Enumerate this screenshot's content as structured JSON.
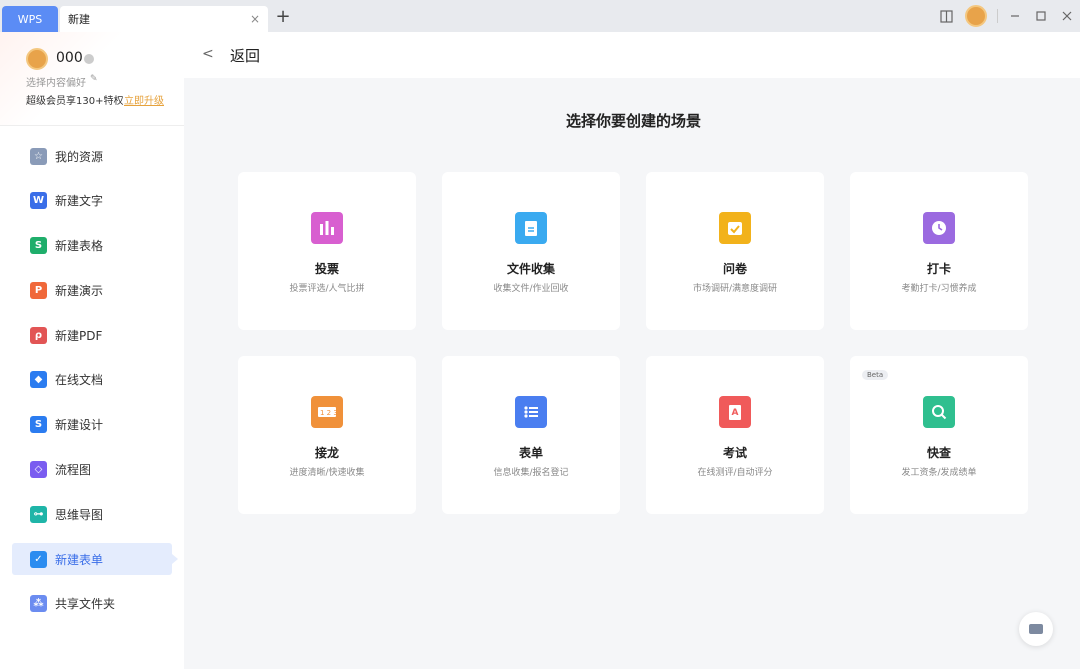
{
  "titlebar": {
    "tab_wps": "WPS",
    "tab_new": "新建",
    "tab_close": "×",
    "tab_add": "+"
  },
  "profile": {
    "name": "000",
    "pref": "选择内容偏好",
    "vip": "超级会员享130+特权",
    "upgrade": "立即升级"
  },
  "sidebar": {
    "items": [
      {
        "label": "我的资源",
        "icon": "star-icon",
        "color": "#8a9bb8",
        "glyph": "☆"
      },
      {
        "label": "新建文字",
        "icon": "word-icon",
        "color": "#3a6ee8",
        "glyph": "W"
      },
      {
        "label": "新建表格",
        "icon": "sheet-icon",
        "color": "#1fae6b",
        "glyph": "S"
      },
      {
        "label": "新建演示",
        "icon": "slides-icon",
        "color": "#f0683a",
        "glyph": "P"
      },
      {
        "label": "新建PDF",
        "icon": "pdf-icon",
        "color": "#e25555",
        "glyph": "ρ"
      },
      {
        "label": "在线文档",
        "icon": "online-doc-icon",
        "color": "#2b7cf0",
        "glyph": "◆"
      },
      {
        "label": "新建设计",
        "icon": "design-icon",
        "color": "#2b7cf0",
        "glyph": "S"
      },
      {
        "label": "流程图",
        "icon": "flowchart-icon",
        "color": "#7a5cf0",
        "glyph": "◇"
      },
      {
        "label": "思维导图",
        "icon": "mindmap-icon",
        "color": "#1fb5a8",
        "glyph": "⊶"
      },
      {
        "label": "新建表单",
        "icon": "form-icon",
        "color": "#2b8cf0",
        "glyph": "✓"
      },
      {
        "label": "共享文件夹",
        "icon": "shared-folder-icon",
        "color": "#6b8cf0",
        "glyph": "⁂"
      }
    ],
    "active_index": 9
  },
  "back": {
    "chevron": "<",
    "label": "返回"
  },
  "main": {
    "title": "选择你要创建的场景",
    "cards": [
      {
        "title": "投票",
        "sub": "投票评选/人气比拼",
        "icon": "vote-icon",
        "color": "#d85fd0"
      },
      {
        "title": "文件收集",
        "sub": "收集文件/作业回收",
        "icon": "file-collect-icon",
        "color": "#3aaaf0"
      },
      {
        "title": "问卷",
        "sub": "市场调研/满意度调研",
        "icon": "survey-icon",
        "color": "#f2b21b"
      },
      {
        "title": "打卡",
        "sub": "考勤打卡/习惯养成",
        "icon": "checkin-icon",
        "color": "#9b6ae0"
      },
      {
        "title": "接龙",
        "sub": "进度清晰/快速收集",
        "icon": "relay-icon",
        "color": "#f0913a"
      },
      {
        "title": "表单",
        "sub": "信息收集/报名登记",
        "icon": "form-list-icon",
        "color": "#4a7ef0"
      },
      {
        "title": "考试",
        "sub": "在线测评/自动评分",
        "icon": "exam-icon",
        "color": "#f05a5a"
      },
      {
        "title": "快查",
        "sub": "发工资条/发成绩单",
        "icon": "quick-search-icon",
        "color": "#2fbf8f",
        "badge": "Beta"
      }
    ]
  }
}
